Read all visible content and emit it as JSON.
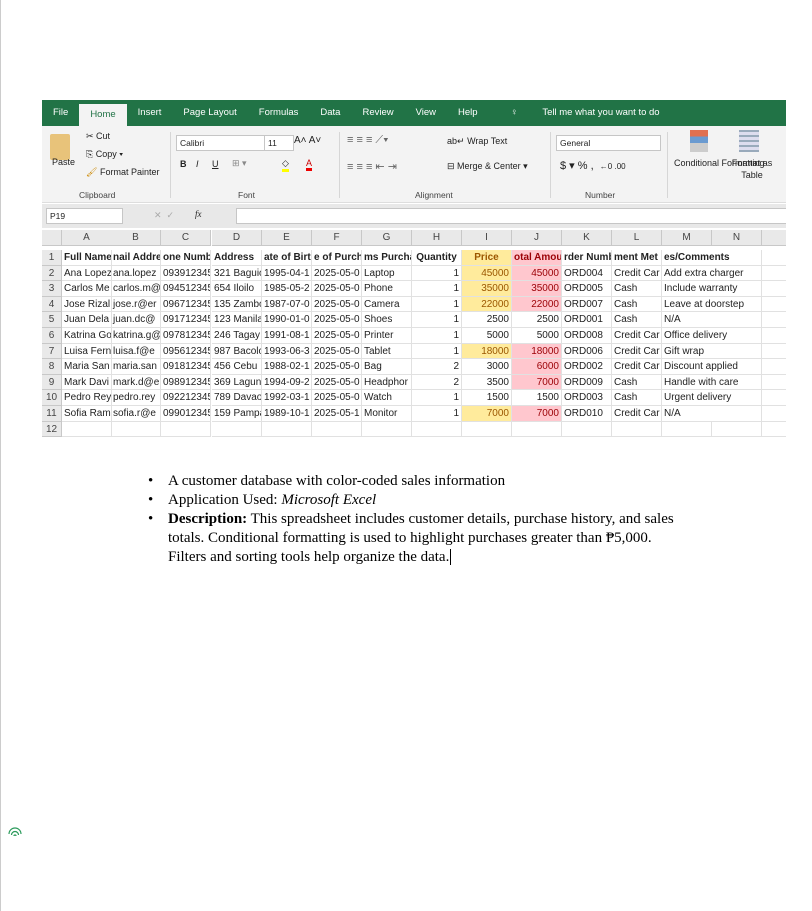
{
  "ribbon": {
    "tabs": [
      "File",
      "Home",
      "Insert",
      "Page Layout",
      "Formulas",
      "Data",
      "Review",
      "View",
      "Help"
    ],
    "tell_me": "Tell me what you want to do",
    "cut": "Cut",
    "copy": "Copy",
    "paste": "Paste",
    "format_painter": "Format Painter",
    "clipboard": "Clipboard",
    "font_name": "Calibri",
    "font_size": "11",
    "font": "Font",
    "wrap_text": "Wrap Text",
    "merge_center": "Merge & Center",
    "alignment": "Alignment",
    "number_format": "General",
    "number": "Number",
    "conditional_formatting": "Conditional Formatting",
    "format_as_table": "Format as Table",
    "bold": "B",
    "italic": "I",
    "underline": "U",
    "currency": "$",
    "percent": "%",
    "comma": ","
  },
  "formula_bar": {
    "name_box": "P19",
    "fx": "fx",
    "value": ""
  },
  "columns": [
    "A",
    "B",
    "C",
    "D",
    "E",
    "F",
    "G",
    "H",
    "I",
    "J",
    "K",
    "L",
    "M",
    "N"
  ],
  "headers": [
    "Full Name",
    "Email Address",
    "Phone Number",
    "Address",
    "Date of Birth",
    "Date of Purchase",
    "Items Purchased",
    "Quantity",
    "Price",
    "Total Amount",
    "Order Number",
    "Payment Method",
    "Notes/Comments"
  ],
  "header_display": [
    "Full Name",
    "nail Addre",
    "one Numb",
    "Address",
    "ate of Birt",
    "e of Purch",
    "ms Purcha",
    "Quantity",
    "Price",
    "otal Amou",
    "rder Numb",
    "ment Met",
    "es/Comments"
  ],
  "rows": [
    [
      "Ana Lopez",
      "ana.lopez",
      "093912345",
      "321 Baguio",
      "1995-04-1",
      "2025-05-0",
      "Laptop",
      "1",
      "45000",
      "45000",
      "ORD004",
      "Credit Car",
      "Add extra charger"
    ],
    [
      "Carlos Me",
      "carlos.m@",
      "094512345",
      "654 Iloilo",
      "1985-05-2",
      "2025-05-0",
      "Phone",
      "1",
      "35000",
      "35000",
      "ORD005",
      "Cash",
      "Include warranty"
    ],
    [
      "Jose Rizal",
      "jose.r@er",
      "096712345",
      "135 Zambo",
      "1987-07-0",
      "2025-05-0",
      "Camera",
      "1",
      "22000",
      "22000",
      "ORD007",
      "Cash",
      "Leave at doorstep"
    ],
    [
      "Juan Dela",
      "juan.dc@",
      "091712345",
      "123 Manila",
      "1990-01-0",
      "2025-05-0",
      "Shoes",
      "1",
      "2500",
      "2500",
      "ORD001",
      "Cash",
      "N/A"
    ],
    [
      "Katrina Go",
      "katrina.g@",
      "097812345",
      "246 Tagay",
      "1991-08-1",
      "2025-05-0",
      "Printer",
      "1",
      "5000",
      "5000",
      "ORD008",
      "Credit Car",
      "Office delivery"
    ],
    [
      "Luisa Fern",
      "luisa.f@e",
      "095612345",
      "987 Bacolo",
      "1993-06-3",
      "2025-05-0",
      "Tablet",
      "1",
      "18000",
      "18000",
      "ORD006",
      "Credit Car",
      "Gift wrap"
    ],
    [
      "Maria San",
      "maria.san",
      "091812345",
      "456 Cebu",
      "1988-02-1",
      "2025-05-0",
      "Bag",
      "2",
      "3000",
      "6000",
      "ORD002",
      "Credit Car",
      "Discount applied"
    ],
    [
      "Mark Davi",
      "mark.d@e",
      "098912345",
      "369 Lagun",
      "1994-09-2",
      "2025-05-0",
      "Headphor",
      "2",
      "3500",
      "7000",
      "ORD009",
      "Cash",
      "Handle with care"
    ],
    [
      "Pedro Rey",
      "pedro.rey",
      "092212345",
      "789 Davao",
      "1992-03-1",
      "2025-05-0",
      "Watch",
      "1",
      "1500",
      "1500",
      "ORD003",
      "Cash",
      "Urgent delivery"
    ],
    [
      "Sofia Ram",
      "sofia.r@e",
      "099012345",
      "159 Pampa",
      "1989-10-1",
      "2025-05-1",
      "Monitor",
      "1",
      "7000",
      "7000",
      "ORD010",
      "Credit Car",
      "N/A"
    ]
  ],
  "highlight_price": [
    true,
    true,
    true,
    false,
    false,
    true,
    false,
    false,
    false,
    true
  ],
  "highlight_total": [
    true,
    true,
    true,
    false,
    false,
    true,
    true,
    true,
    false,
    true
  ],
  "colors": {
    "green": "#217346",
    "price_fill": "#ffeb9c",
    "price_text": "#9c5700",
    "total_fill": "#ffc7ce",
    "total_text": "#9c0006"
  },
  "doc": {
    "b1": "A customer database with color-coded sales information",
    "b2_label": "Application Used: ",
    "b2_value": "Microsoft Excel",
    "b3_label": "Description:",
    "b3_text": " This spreadsheet includes customer details, purchase history, and sales totals. Conditional formatting is used to highlight purchases greater than ₱5,000. Filters and sorting tools help organize the data."
  }
}
